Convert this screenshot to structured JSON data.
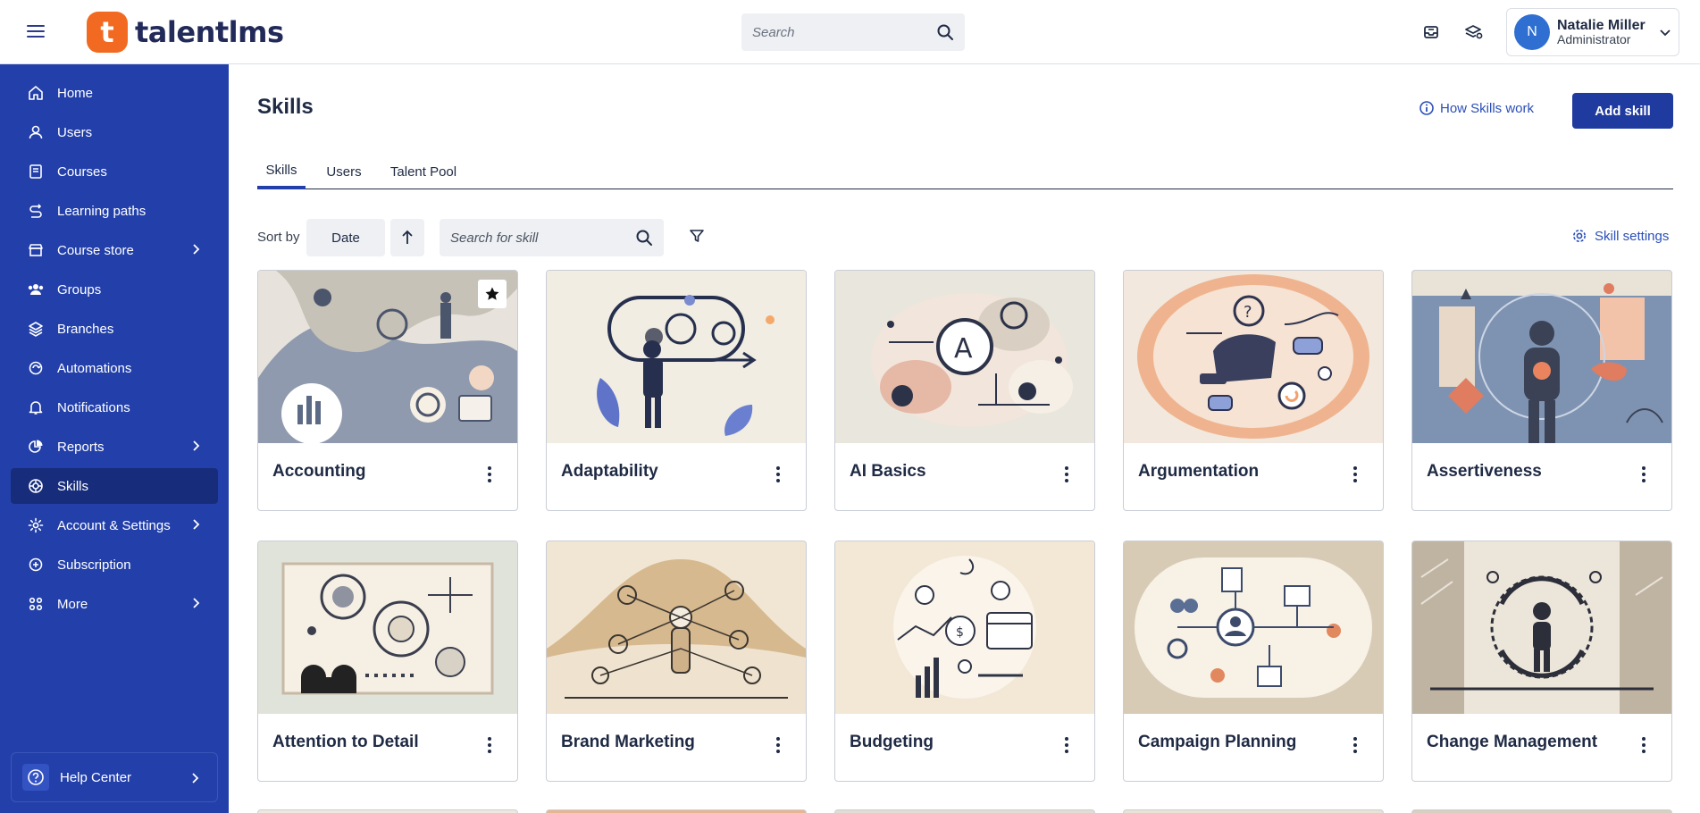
{
  "app": {
    "logo_letter": "t",
    "logo_text": "talentlms"
  },
  "topbar": {
    "search_placeholder": "Search",
    "user": {
      "initial": "N",
      "name": "Natalie Miller",
      "role": "Administrator"
    }
  },
  "sidebar": {
    "items": [
      {
        "label": "Home",
        "icon": "home-icon"
      },
      {
        "label": "Users",
        "icon": "user-icon"
      },
      {
        "label": "Courses",
        "icon": "book-icon"
      },
      {
        "label": "Learning paths",
        "icon": "path-icon"
      },
      {
        "label": "Course store",
        "icon": "store-icon",
        "has_submenu": true
      },
      {
        "label": "Groups",
        "icon": "groups-icon"
      },
      {
        "label": "Branches",
        "icon": "layers-icon"
      },
      {
        "label": "Automations",
        "icon": "automation-icon"
      },
      {
        "label": "Notifications",
        "icon": "bell-icon"
      },
      {
        "label": "Reports",
        "icon": "pie-chart-icon",
        "has_submenu": true
      },
      {
        "label": "Skills",
        "icon": "skills-icon",
        "active": true
      },
      {
        "label": "Account & Settings",
        "icon": "gear-icon",
        "has_submenu": true
      },
      {
        "label": "Subscription",
        "icon": "subscription-icon"
      },
      {
        "label": "More",
        "icon": "grid-icon",
        "has_submenu": true
      }
    ],
    "help_label": "Help Center"
  },
  "main": {
    "title": "Skills",
    "how_link": "How Skills work",
    "add_button": "Add skill",
    "tabs": [
      {
        "label": "Skills",
        "active": true
      },
      {
        "label": "Users"
      },
      {
        "label": "Talent Pool"
      }
    ],
    "sort_label": "Sort by",
    "sort_value": "Date",
    "skill_search_placeholder": "Search for skill",
    "settings_link": "Skill settings",
    "cards": [
      {
        "title": "Accounting",
        "starred": true
      },
      {
        "title": "Adaptability"
      },
      {
        "title": "AI Basics"
      },
      {
        "title": "Argumentation"
      },
      {
        "title": "Assertiveness"
      },
      {
        "title": "Attention to Detail"
      },
      {
        "title": "Brand Marketing"
      },
      {
        "title": "Budgeting"
      },
      {
        "title": "Campaign Planning"
      },
      {
        "title": "Change Management"
      }
    ]
  },
  "colors": {
    "sidebar": "#2340aa",
    "sidebar_active": "#172d7b",
    "primary_button": "#1f3b9f",
    "link": "#2b4fb8",
    "logo": "#f26a21"
  }
}
